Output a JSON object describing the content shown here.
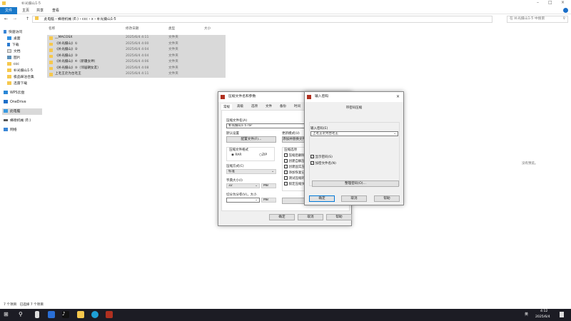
{
  "window": {
    "title": "补光摄山1-5",
    "minimize": "–",
    "maximize": "□",
    "close": "×"
  },
  "ribbon": {
    "tabs": [
      "文件",
      "主页",
      "共享",
      "查看"
    ],
    "active_color": "#1979ca"
  },
  "address": {
    "crumbs": [
      "此电脑",
      "蜂德机械 (E:)",
      "ccc",
      "x",
      "补光摄山1-5"
    ],
    "search_placeholder": "在 补光摄山1-5 中搜索"
  },
  "sidebar": {
    "items": [
      "快速访问",
      "桌面",
      "下载",
      "文档",
      "图片",
      "ccc",
      "补光摄山1-5",
      "极品踩泊合集",
      "迅雷下载",
      "WPS云盘",
      "OneDrive",
      "此电脑",
      "蜂德机械 (E:)",
      "网络"
    ]
  },
  "columns": [
    "名称",
    "修改日期",
    "类型",
    "大小"
  ],
  "files": [
    {
      "name": "__MACOSX",
      "date": "2025/6/4 4:11",
      "type": "文件夹"
    },
    {
      "name": "《补光摄山》①",
      "date": "2025/6/4 4:00",
      "type": "文件夹"
    },
    {
      "name": "《补光摄山》②",
      "date": "2025/6/4 4:04",
      "type": "文件夹"
    },
    {
      "name": "《补光摄山》③",
      "date": "2025/6/4 4:04",
      "type": "文件夹"
    },
    {
      "name": "《补光摄山》④（新疆女神）",
      "date": "2025/6/4 4:06",
      "type": "文件夹"
    },
    {
      "name": "《补光摄山》⑤（邻居朝女友）",
      "date": "2025/6/4 4:08",
      "type": "文件夹"
    },
    {
      "name": "上毛王沦为台毛王",
      "date": "2025/6/4 4:11",
      "type": "文件夹"
    }
  ],
  "preview_text": "没有预览。",
  "status": {
    "count": "7 个项目",
    "selected": "已选择 7 个项目"
  },
  "archive_dialog": {
    "title": "压缩文件名和参数",
    "tabs": [
      "常规",
      "高级",
      "选项",
      "文件",
      "备份",
      "时间"
    ],
    "name_label": "压缩文件名(A)",
    "name_value": "补光摄山1-5.rar",
    "default_label": "默认设置",
    "profile_button": "配置文件(F)...",
    "update_label": "更新模式(U)",
    "update_value": "添加并替换文件",
    "format_label": "压缩文件格式",
    "format_rar": "RAR",
    "format_zip": "ZIP",
    "format_selected": "RAR",
    "method_label": "压缩方式(C)",
    "method_value": "标准",
    "dict_label": "字典大小(I)",
    "dict_value": "32",
    "dict_unit": "MB",
    "split_label": "切分为分卷(V)，大小",
    "split_unit": "MB",
    "options_label": "压缩选项",
    "options": [
      "压缩后删除原来的文件",
      "创建自解压格式压缩文件",
      "创建固实压缩文件",
      "添加恢复记录",
      "测试压缩的文件",
      "锁定压缩文件"
    ],
    "ok": "确定",
    "cancel": "取消",
    "help": "帮助"
  },
  "password_dialog": {
    "title": "输入密码",
    "heading": "带密码压缩",
    "label": "输入密码(E)",
    "value": "上毛王沦为台毛王",
    "show_password": "显示密码(S)",
    "encrypt_names": "加密文件名(N)",
    "organize": "整理密码(O)...",
    "ok": "确定",
    "cancel": "取消",
    "help": "帮助"
  },
  "taskbar": {
    "time": "4:12",
    "date": "2025/6/4",
    "ime": "英"
  }
}
